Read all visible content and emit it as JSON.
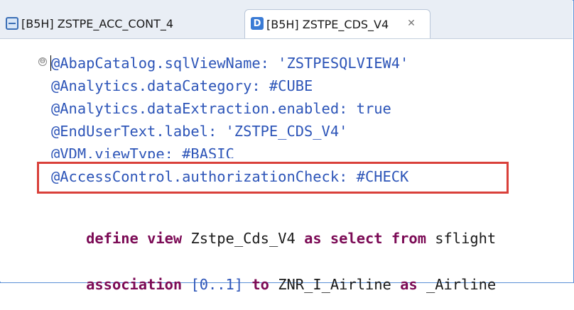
{
  "tabs": [
    {
      "label": "[B5H] ZSTPE_ACC_CONT_4",
      "icon": "table-icon",
      "active": false
    },
    {
      "label": "[B5H] ZSTPE_CDS_V4",
      "icon": "ddl-source-icon",
      "icon_letter": "D",
      "active": true,
      "close_symbol": "✕"
    }
  ],
  "editor": {
    "fold_symbol": "⊖",
    "lines": {
      "l1": "@AbapCatalog.sqlViewName: 'ZSTPESQLVIEW4'",
      "l2": "@Analytics.dataCategory: #CUBE",
      "l3": "@Analytics.dataExtraction.enabled: true",
      "l4": "@EndUserText.label: 'ZSTPE_CDS_V4'",
      "l5": "@VDM.viewType: #BASIC",
      "l6": "@AccessControl.authorizationCheck: #CHECK",
      "l7": {
        "kw1": "define",
        "kw2": "view",
        "name": "Zstpe_Cds_V4",
        "kw3": "as",
        "kw4": "select",
        "kw5": "from",
        "src": "sflight"
      },
      "l8": {
        "kw1": "association",
        "card": "[0..1]",
        "kw2": "to",
        "target": "ZNR_I_Airline",
        "kw3": "as",
        "alias": "_Airline"
      }
    }
  },
  "colors": {
    "annotation": "#2d55b8",
    "keyword": "#7b0a55",
    "highlight_border": "#d9403a",
    "frame": "#5b8fd6"
  }
}
